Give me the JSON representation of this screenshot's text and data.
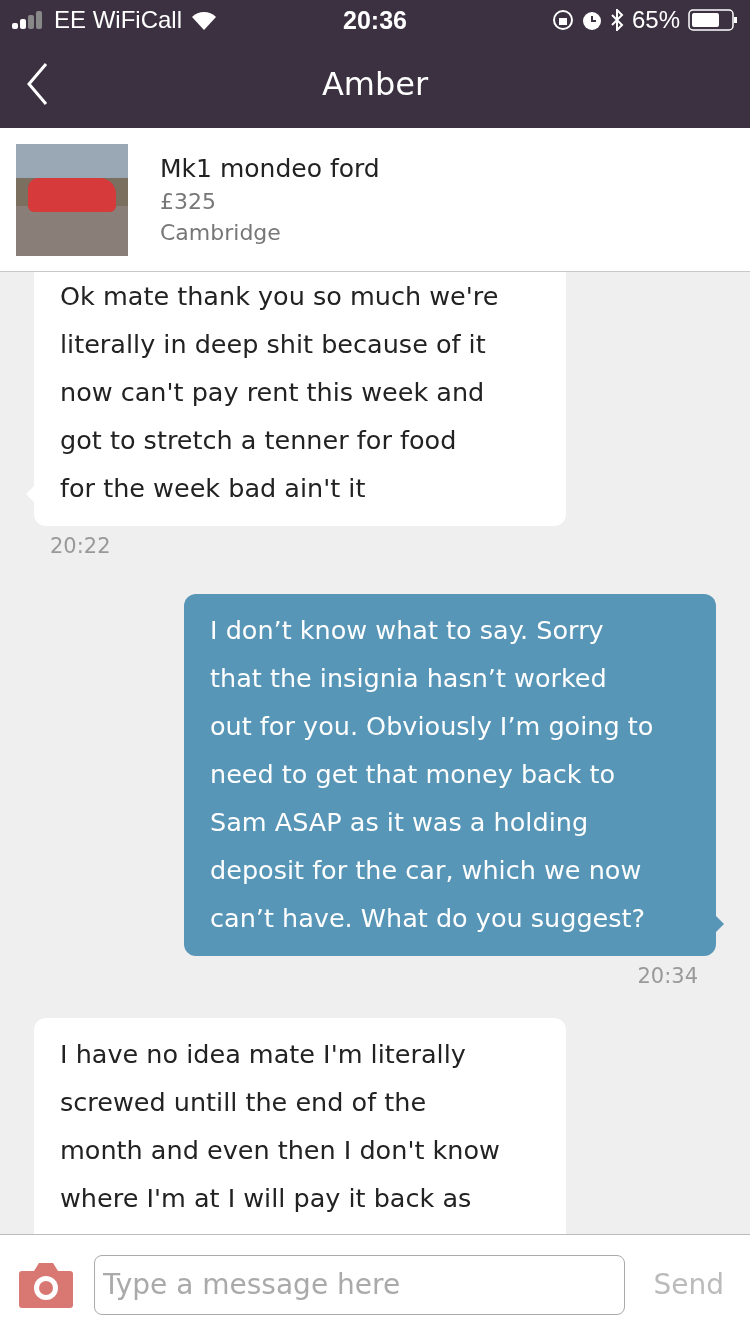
{
  "status_bar": {
    "carrier": "EE WiFiCall",
    "time": "20:36",
    "battery": "65%"
  },
  "nav": {
    "title": "Amber"
  },
  "listing": {
    "title": "Mk1 mondeo ford",
    "price": "£325",
    "location": "Cambridge"
  },
  "messages": [
    {
      "kind": "received",
      "text": "Ok mate thank you so much we're\nliterally in deep shit because of it\nnow can't pay rent this week and\ngot to stretch a tenner for food\nfor the week bad ain't it",
      "time": "20:22",
      "clipped_top": true,
      "clipped_bottom": false
    },
    {
      "kind": "sent",
      "text": "I don’t know what to say. Sorry\nthat the insignia hasn’t worked\nout for you. Obviously I’m going to\nneed to get that money back to\nSam ASAP as it was a holding\ndeposit for the car, which we now\ncan’t have. What do you suggest?",
      "time": "20:34",
      "clipped_top": false,
      "clipped_bottom": false
    },
    {
      "kind": "received",
      "text": "I have no idea mate I'm literally\nscrewed untill the end of the\nmonth and even then I don't know\nwhere I'm at I will pay it back as",
      "clipped_top": false,
      "clipped_bottom": true
    }
  ],
  "composer": {
    "placeholder": "Type a message here",
    "send": "Send"
  }
}
